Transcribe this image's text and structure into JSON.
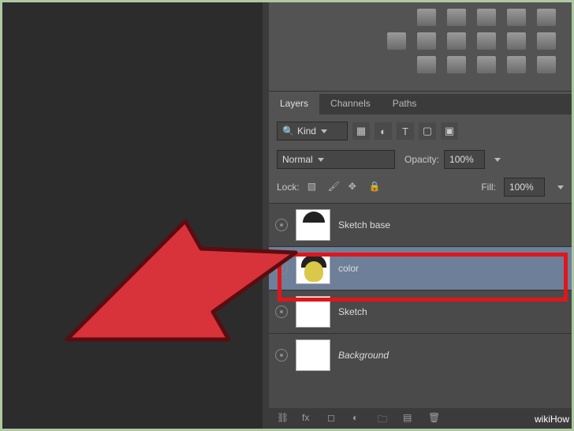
{
  "tabs": {
    "layers": "Layers",
    "channels": "Channels",
    "paths": "Paths"
  },
  "filter": {
    "kind": "Kind"
  },
  "blend": {
    "mode": "Normal",
    "opacity_label": "Opacity:",
    "opacity_value": "100%"
  },
  "lock": {
    "label": "Lock:",
    "fill_label": "Fill:",
    "fill_value": "100%"
  },
  "layers": [
    {
      "name": "Sketch base"
    },
    {
      "name": "color"
    },
    {
      "name": "Sketch"
    },
    {
      "name": "Background"
    }
  ],
  "watermark": "wikiHow"
}
